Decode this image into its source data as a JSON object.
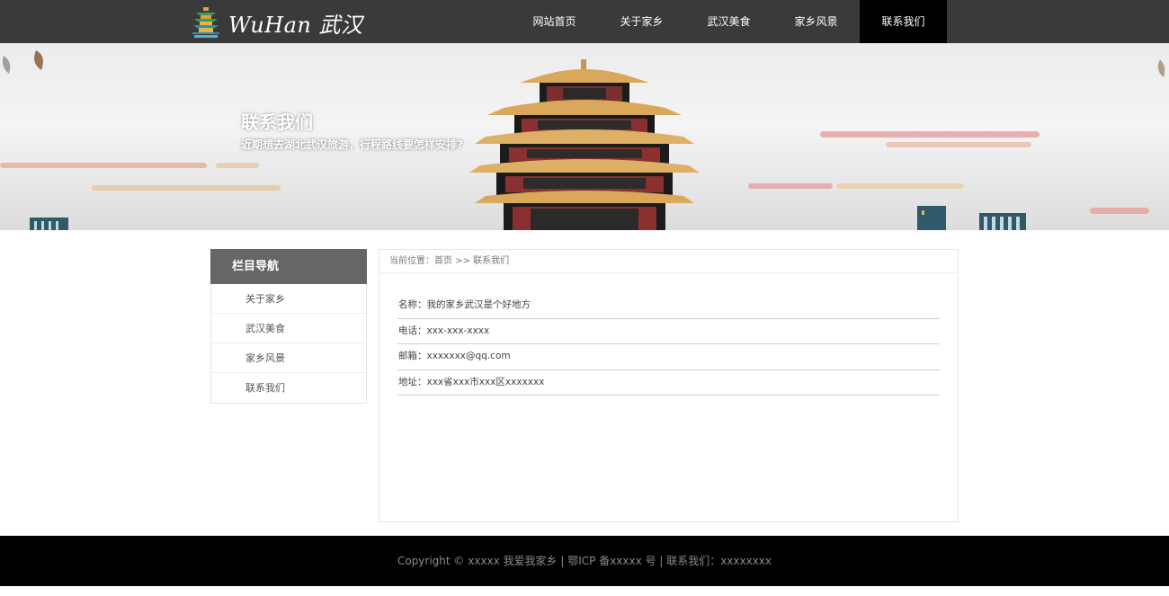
{
  "header": {
    "logo_text": "WuHan 武汉",
    "nav": [
      {
        "label": "网站首页",
        "active": false
      },
      {
        "label": "关于家乡",
        "active": false
      },
      {
        "label": "武汉美食",
        "active": false
      },
      {
        "label": "家乡风景",
        "active": false
      },
      {
        "label": "联系我们",
        "active": true
      }
    ]
  },
  "banner": {
    "title": "联系我们",
    "subtitle": "近期想去湖北武汉旅游，行程路线要怎样安排?"
  },
  "sidebar": {
    "heading": "栏目导航",
    "items": [
      {
        "label": "关于家乡"
      },
      {
        "label": "武汉美食"
      },
      {
        "label": "家乡风景"
      },
      {
        "label": "联系我们"
      }
    ]
  },
  "breadcrumb": {
    "prefix": "当前位置：",
    "home": "首页",
    "separator": " >> ",
    "current": "联系我们"
  },
  "contact": {
    "rows": [
      {
        "label": "名称：",
        "value": "我的家乡武汉是个好地方"
      },
      {
        "label": "电话：",
        "value": "xxx-xxx-xxxx"
      },
      {
        "label": "邮箱：",
        "value": "xxxxxxx@qq.com"
      },
      {
        "label": "地址：",
        "value": "xxx省xxx市xxx区xxxxxxx"
      }
    ]
  },
  "footer": {
    "text": "Copyright © xxxxx 我爱我家乡 | 鄂ICP 备xxxxx 号 | 联系我们：xxxxxxxx"
  },
  "colors": {
    "header_bg": "#3a3a3a",
    "nav_active_bg": "#000000",
    "sidebar_head_bg": "#666666",
    "footer_bg": "#000000"
  },
  "icons": {
    "logo": "yellow-crane-tower-logo-icon"
  }
}
